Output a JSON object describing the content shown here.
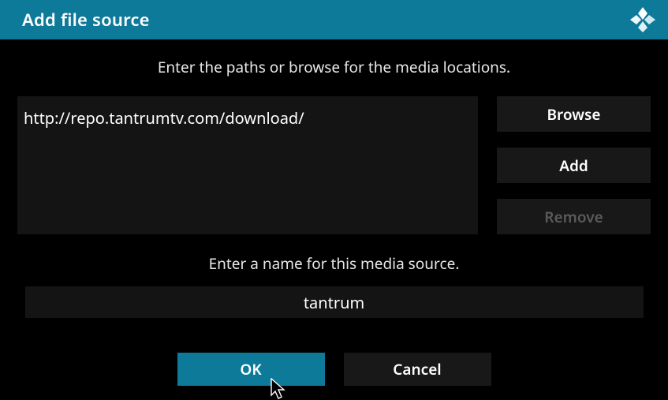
{
  "header": {
    "title": "Add file source"
  },
  "instructions": {
    "paths": "Enter the paths or browse for the media locations.",
    "name": "Enter a name for this media source."
  },
  "paths": [
    "http://repo.tantrumtv.com/download/"
  ],
  "buttons": {
    "browse": "Browse",
    "add": "Add",
    "remove": "Remove",
    "ok": "OK",
    "cancel": "Cancel"
  },
  "source_name": "tantrum",
  "colors": {
    "accent": "#0e7a99",
    "panel": "#141414",
    "button": "#181818",
    "disabled_text": "#5a5a5a"
  }
}
